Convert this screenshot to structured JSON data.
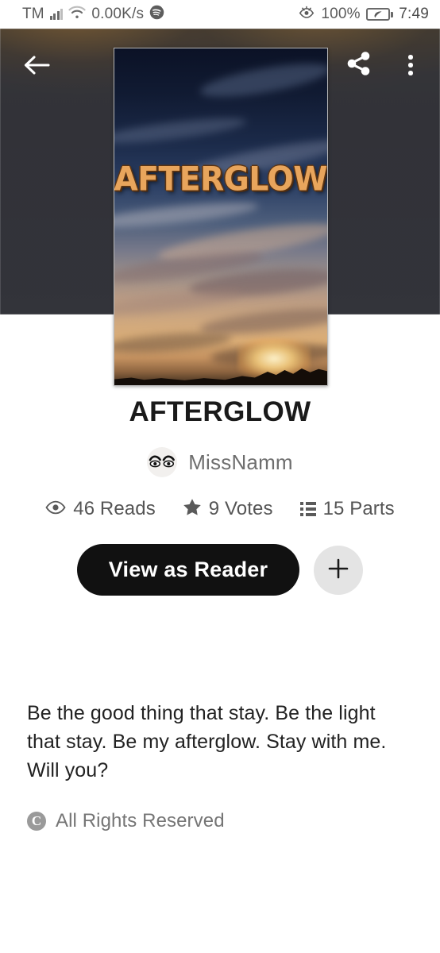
{
  "status_bar": {
    "carrier": "TM",
    "network_speed": "0.00K/s",
    "battery_percent": "100%",
    "time": "7:49",
    "icons": {
      "signal": "signal-bars-icon",
      "wifi": "wifi-icon",
      "music": "spotify-icon",
      "eye_comfort": "eye-protection-icon",
      "battery": "battery-eco-icon"
    }
  },
  "header": {
    "back_icon": "back-arrow-icon",
    "share_icon": "share-icon",
    "more_icon": "overflow-menu-icon"
  },
  "cover": {
    "title_art": "AFTERGLOW",
    "alt": "sunset sky with golden clouds and dark tree silhouette"
  },
  "story": {
    "title": "AFTERGLOW",
    "author": "MissNamm",
    "avatar_icon": "eyes-avatar-icon",
    "stats": [
      {
        "icon": "eye-icon",
        "label": "46 Reads"
      },
      {
        "icon": "star-icon",
        "label": "9 Votes"
      },
      {
        "icon": "list-icon",
        "label": "15 Parts"
      }
    ],
    "reads_value": "46",
    "votes_value": "9",
    "parts_value": "15",
    "primary_action": "View as Reader",
    "add_action": "+",
    "description": "Be the good thing that stay. Be the light that stay. Be my afterglow. Stay with me.\nWill you?",
    "rights": "All Rights Reserved",
    "rights_icon": "copyright-icon"
  },
  "colors": {
    "accent_dark": "#111111",
    "cover_title": "#e8a55c",
    "backdrop": "#3a3b42",
    "muted_text": "#757575"
  }
}
